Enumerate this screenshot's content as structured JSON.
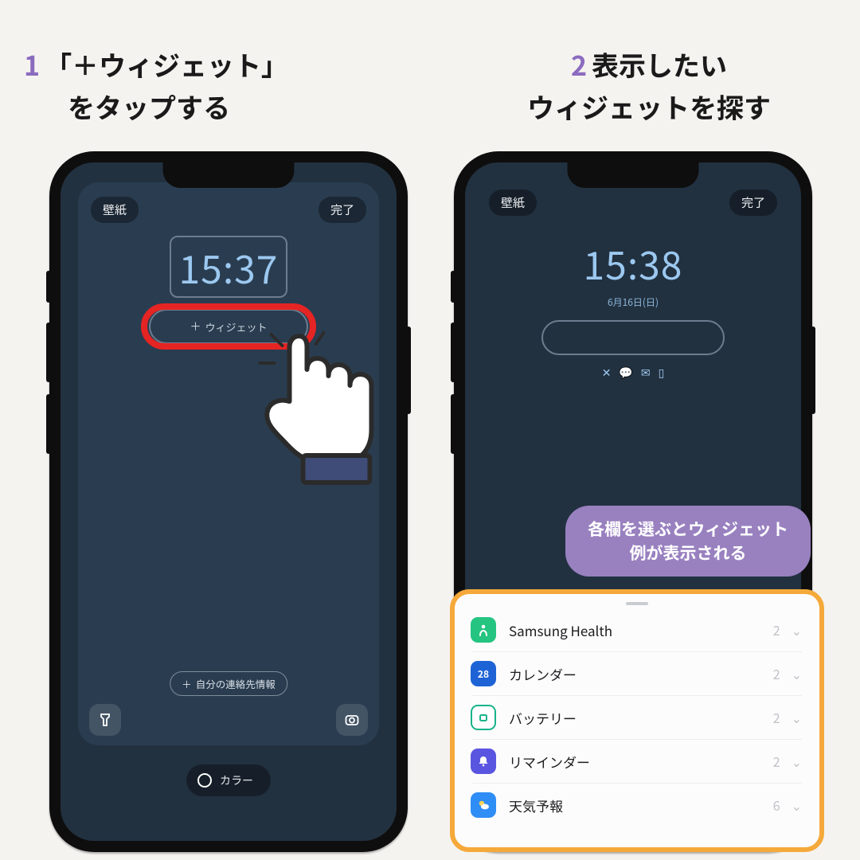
{
  "steps": {
    "s1": {
      "num": "1",
      "line1": "「＋ウィジェット」",
      "line2": "をタップする"
    },
    "s2": {
      "num": "2",
      "line1": "表示したい",
      "line2": "ウィジェットを探す"
    }
  },
  "left_screen": {
    "btn_wallpaper": "壁紙",
    "btn_done": "完了",
    "clock": "15:37",
    "add_widget_label": "ウィジェット",
    "contact_label": "自分の連絡先情報",
    "color_label": "カラー"
  },
  "right_screen": {
    "btn_wallpaper": "壁紙",
    "btn_done": "完了",
    "clock": "15:38",
    "date": "6月16日(日)",
    "icons": [
      "missed-call-icon",
      "chat-icon",
      "mail-icon",
      "phone-icon"
    ]
  },
  "callout": {
    "line1": "各欄を選ぶとウィジェット",
    "line2": "例が表示される"
  },
  "widgets": [
    {
      "icon": "health",
      "name": "Samsung Health",
      "count": "2"
    },
    {
      "icon": "calendar",
      "name": "カレンダー",
      "count": "2",
      "badge": "28"
    },
    {
      "icon": "battery",
      "name": "バッテリー",
      "count": "2"
    },
    {
      "icon": "reminder",
      "name": "リマインダー",
      "count": "2"
    },
    {
      "icon": "weather",
      "name": "天気予報",
      "count": "6"
    }
  ]
}
